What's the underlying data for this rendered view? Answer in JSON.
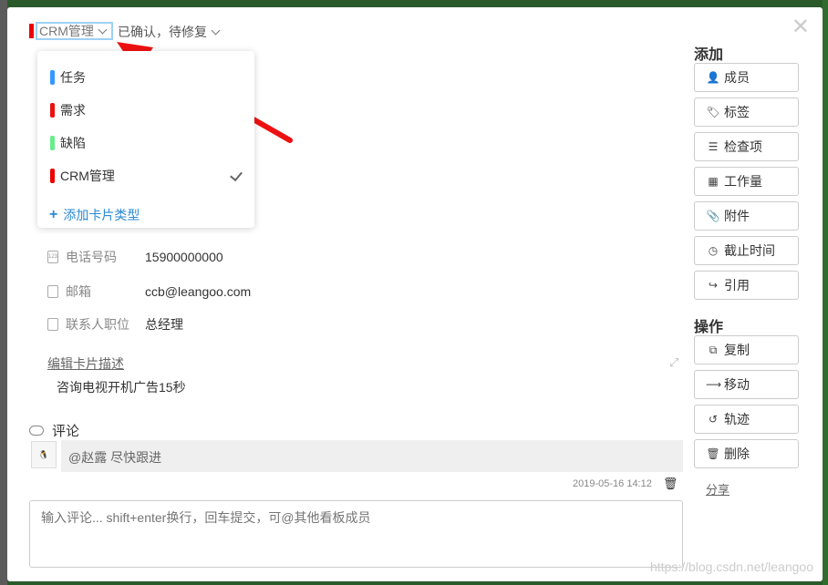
{
  "card": {
    "type_label": "CRM管理",
    "type_color": "#ee0000",
    "status_label": "已确认，待修复"
  },
  "dropdown": {
    "items": [
      {
        "label": "任务",
        "color": "#3399ff",
        "selected": false
      },
      {
        "label": "需求",
        "color": "#ee1111",
        "selected": false
      },
      {
        "label": "缺陷",
        "color": "#66ee88",
        "selected": false
      },
      {
        "label": "CRM管理",
        "color": "#ee0000",
        "selected": true
      }
    ],
    "add_label": "添加卡片类型"
  },
  "fields": [
    {
      "icon": "phone-card-icon",
      "label": "电话号码",
      "value": "15900000000"
    },
    {
      "icon": "document-icon",
      "label": "邮箱",
      "value": "ccb@leangoo.com"
    },
    {
      "icon": "document-icon",
      "label": "联系人职位",
      "value": "总经理"
    }
  ],
  "description": {
    "edit_label": "编辑卡片描述",
    "text": "咨询电视开机广告15秒"
  },
  "comments": {
    "title": "评论",
    "items": [
      {
        "text": "@赵露 尽快跟进",
        "timestamp": "2019-05-16 14:12"
      }
    ],
    "input_placeholder": "输入评论... shift+enter换行，回车提交，可@其他看板成员"
  },
  "sidebar": {
    "add_title": "添加",
    "add_buttons": [
      {
        "icon": "add-user-icon",
        "glyph": "👤",
        "label": "成员"
      },
      {
        "icon": "tag-icon",
        "glyph": "🏷",
        "label": "标签"
      },
      {
        "icon": "list-icon",
        "glyph": "☰",
        "label": "检查项"
      },
      {
        "icon": "grid-icon",
        "glyph": "▦",
        "label": "工作量"
      },
      {
        "icon": "paperclip-icon",
        "glyph": "📎",
        "label": "附件"
      },
      {
        "icon": "clock-icon",
        "glyph": "◷",
        "label": "截止时间"
      },
      {
        "icon": "share-arrow-icon",
        "glyph": "↪",
        "label": "引用"
      }
    ],
    "ops_title": "操作",
    "ops_buttons": [
      {
        "icon": "copy-icon",
        "glyph": "⧉",
        "label": "复制"
      },
      {
        "icon": "move-arrow-icon",
        "glyph": "⟶",
        "label": "移动"
      },
      {
        "icon": "history-icon",
        "glyph": "↺",
        "label": "轨迹"
      },
      {
        "icon": "trash-icon",
        "glyph": "🗑",
        "label": "删除"
      }
    ],
    "share_label": "分享"
  },
  "watermark": "https://blog.csdn.net/leangoo"
}
